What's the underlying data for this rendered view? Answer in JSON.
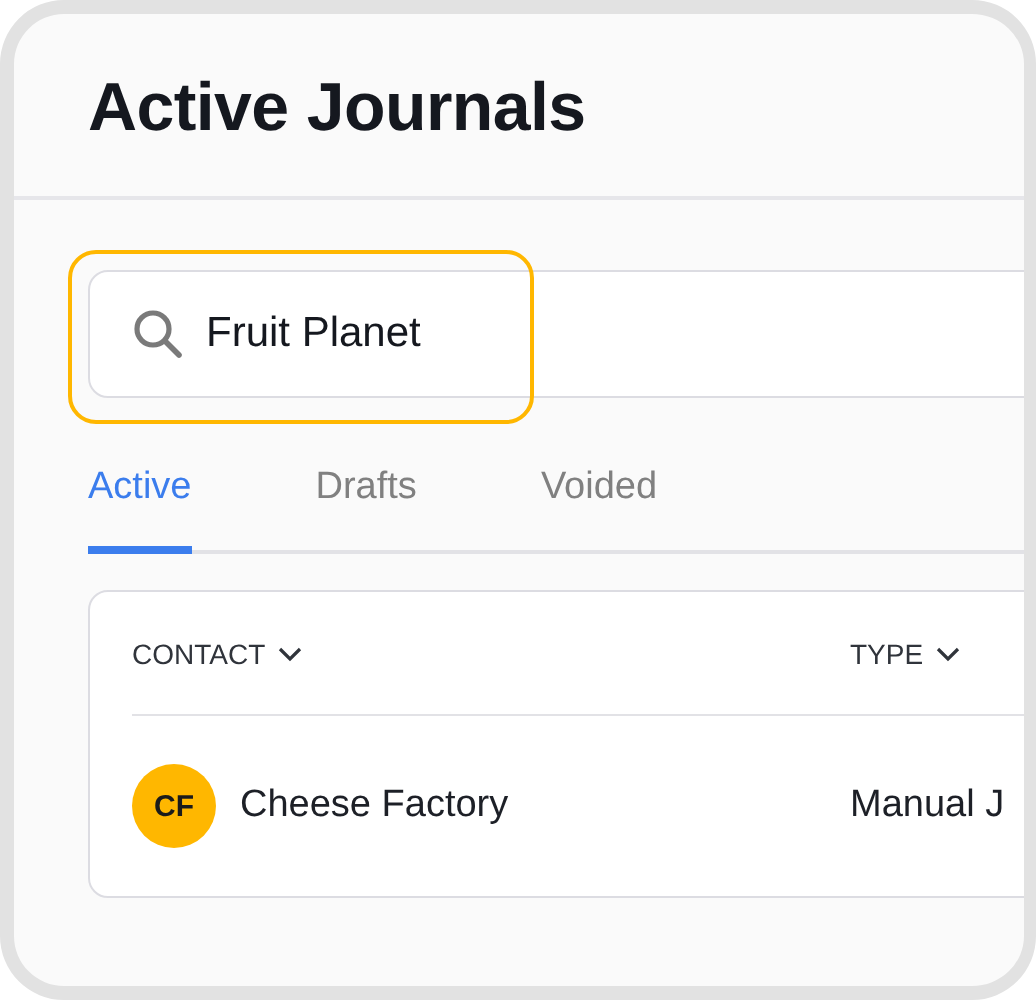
{
  "header": {
    "title": "Active Journals"
  },
  "search": {
    "value": "Fruit Planet",
    "highlighted": true
  },
  "tabs": [
    {
      "label": "Active",
      "selected": true
    },
    {
      "label": "Drafts",
      "selected": false
    },
    {
      "label": "Voided",
      "selected": false
    }
  ],
  "table": {
    "columns": [
      "CONTACT",
      "TYPE"
    ],
    "rows": [
      {
        "initials": "CF",
        "color": "#ffb700",
        "contact": "Cheese Factory",
        "type": "Manual J"
      }
    ]
  }
}
